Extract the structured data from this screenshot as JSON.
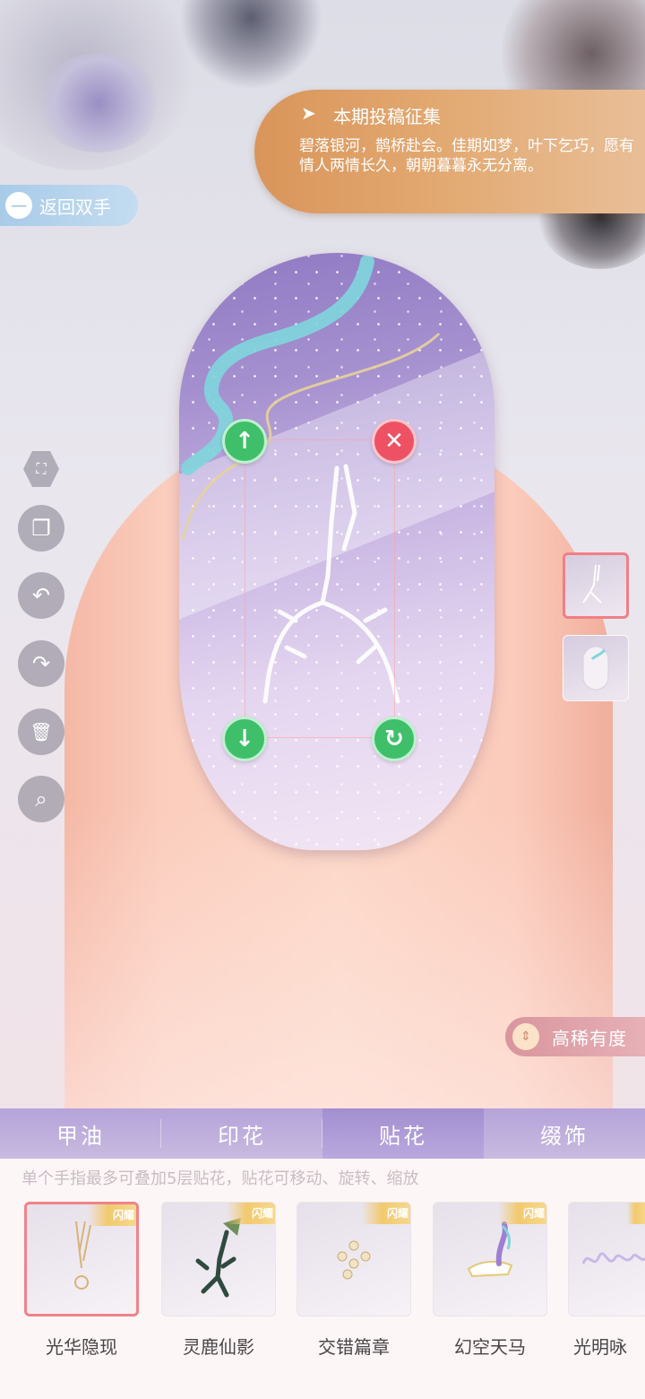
{
  "notice": {
    "title": "本期投稿征集",
    "body": "碧落银河，鹊桥赴会。佳期如梦，叶下乞巧，愿有情人两情长久，朝朝暮暮永无分离。",
    "icon": "sparkle-icon"
  },
  "back_button": {
    "label": "返回双手",
    "icon": "arrow-left-icon"
  },
  "tools": [
    {
      "name": "fullscreen-icon",
      "glyph": "⛶"
    },
    {
      "name": "copy-icon",
      "glyph": "❐"
    },
    {
      "name": "undo-icon",
      "glyph": "↶"
    },
    {
      "name": "redo-icon",
      "glyph": "↷"
    },
    {
      "name": "trash-icon",
      "glyph": "🗑"
    },
    {
      "name": "zoom-icon",
      "glyph": "⌕"
    }
  ],
  "controls": {
    "up": "↑",
    "down": "↓",
    "delete": "✕",
    "rotate": "↻"
  },
  "sort": {
    "label": "高稀有度",
    "icon": "sort-icon"
  },
  "tabs": [
    {
      "label": "甲油",
      "active": false
    },
    {
      "label": "印花",
      "active": false
    },
    {
      "label": "贴花",
      "active": true
    },
    {
      "label": "缀饰",
      "active": false
    }
  ],
  "hint": "单个手指最多可叠加5层贴花，贴花可移动、旋转、缩放",
  "items": [
    {
      "name": "光华隐现",
      "badge": "闪耀",
      "selected": true
    },
    {
      "name": "灵鹿仙影",
      "badge": "闪耀",
      "selected": false
    },
    {
      "name": "交错篇章",
      "badge": "闪耀",
      "selected": false
    },
    {
      "name": "幻空天马",
      "badge": "闪耀",
      "selected": false
    },
    {
      "name": "光明咏",
      "badge": "",
      "selected": false
    }
  ],
  "colors": {
    "accent_pink": "#f0828a",
    "tab_purple": "#b5a3da",
    "control_green": "#3fbf6a",
    "control_red": "#ef5164",
    "notice_orange": "#e2a870"
  }
}
